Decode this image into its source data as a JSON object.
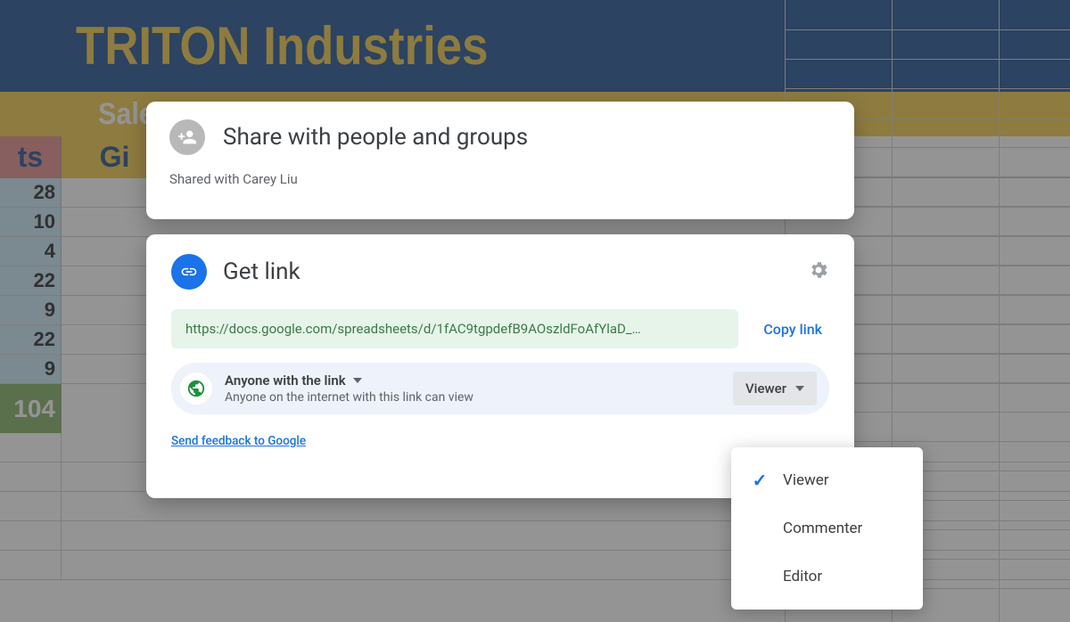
{
  "banner": {
    "title": "TRITON Industries",
    "subtitle": "Sale"
  },
  "sheet": {
    "header_cells": [
      "ts",
      "Gi"
    ],
    "col1_values": [
      "28",
      "10",
      "4",
      "22",
      "9",
      "22",
      "9"
    ],
    "col1_total": "104"
  },
  "share_panel": {
    "title": "Share with people and groups",
    "shared_with": "Shared with Carey Liu"
  },
  "link_panel": {
    "title": "Get link",
    "url": "https://docs.google.com/spreadsheets/d/1fAC9tgpdefB9AOszldFoAfYlaD_…",
    "copy_label": "Copy link",
    "access": {
      "title": "Anyone with the link",
      "subtitle": "Anyone on the internet with this link can view"
    },
    "role_button": "Viewer",
    "feedback": "Send feedback to Google"
  },
  "role_menu": {
    "options": [
      "Viewer",
      "Commenter",
      "Editor"
    ],
    "selected": "Viewer"
  }
}
